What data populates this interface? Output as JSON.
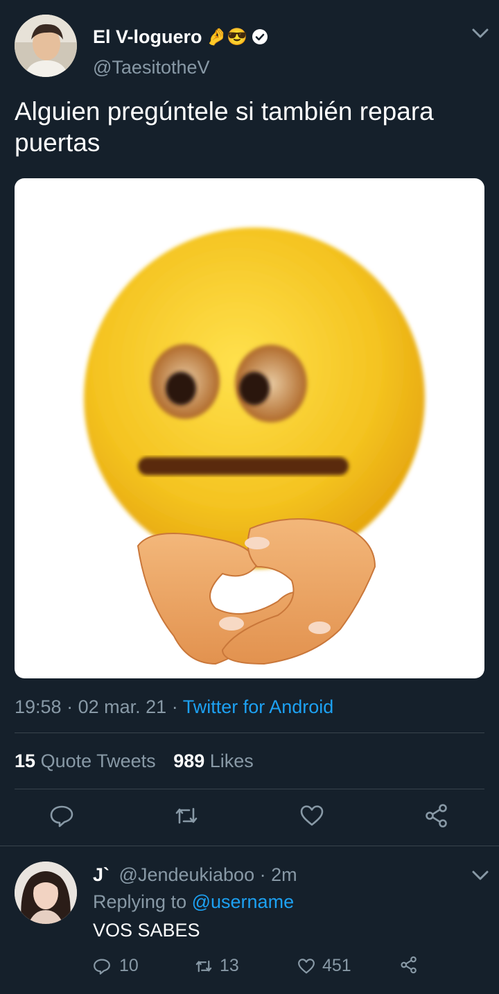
{
  "tweet": {
    "author_name": "El V-loguero",
    "author_emoji": "🤌😎",
    "author_handle": "@TaesitotheV",
    "text_line1": "Alguien pregúntele si también repara",
    "text_line2": "puertas",
    "time": "19:58",
    "date": "02 mar. 21",
    "sep": "·",
    "source": "Twitter for Android",
    "quote_count": "15",
    "quote_label": "Quote Tweets",
    "like_count": "989",
    "like_label": "Likes"
  },
  "reply": {
    "author_name": "J`",
    "author_handle": "@Jendeukiaboo",
    "time_ago": "· 2m",
    "replying_label": "Replying to",
    "replying_to": "@username",
    "text": "VOS SABES",
    "reply_count": "10",
    "retweet_count": "13",
    "like_count": "451"
  },
  "colors": {
    "background": "#15202b",
    "muted": "#8899a6",
    "link": "#1da1f2",
    "divider": "#38444d"
  },
  "icons": [
    "chevron-down-icon",
    "verified-icon",
    "reply-icon",
    "retweet-icon",
    "like-icon",
    "share-icon"
  ]
}
